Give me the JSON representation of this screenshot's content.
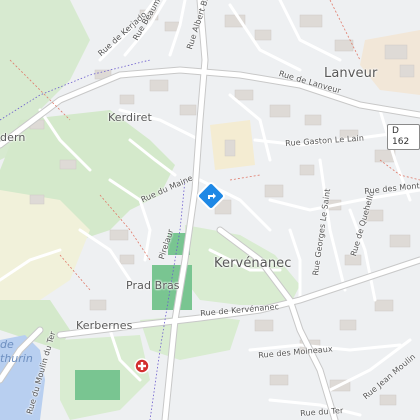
{
  "map": {
    "places": {
      "lanveur": "Lanveur",
      "kervenanec": "Kervénanec",
      "kerdiret": "Kerdiret",
      "prad_bras": "Prad Bras",
      "kerbernes": "Kerbernes",
      "dern": "dern"
    },
    "streets": {
      "rue_de_lanveur": "Rue de Lanveur",
      "rue_gaston_le_lain": "Rue Gaston Le Lain",
      "rue_du_maine": "Rue du Maine",
      "rue_de_kervenanec": "Rue de Kervénanec",
      "rue_des_moineaux": "Rue des Moineaux",
      "rue_de_quehello": "Rue de Quehello",
      "rue_georges_le_saint": "Rue Georges Le Saint",
      "rue_des_montagnes": "Rue des Monta",
      "rue_jean_moulin": "Rue Jean Moulin",
      "rue_du_moulin_du_ter": "Rue du Moulin du Ter",
      "rue_de_kerjado": "Rue de Kerjado",
      "rue_beaumont": "Rue Beaumont",
      "rue_albert_bricquette": "Rue Albert Bricquette",
      "rue_du_ter": "Rue du Ter",
      "pirelaur": "Pirelaur"
    },
    "road_shield": "D 162",
    "water_label": "thurin",
    "water_label_2": "de",
    "markers": {
      "main_pin_icon": "diamond-direction-icon",
      "hospital_icon": "red-cross-icon"
    },
    "colors": {
      "background": "#eef0f2",
      "park": "#d8ecd0",
      "park_dark": "#c9e3bf",
      "woodland": "#cfe6c4",
      "field": "#f0f0d8",
      "sports_pitch": "#77c48f",
      "water": "#b8cff0",
      "building": "#e0dcd8",
      "road": "#ffffff",
      "road_casing": "#c8c8c8",
      "marker": "#1e88e5",
      "hospital": "#d32f2f"
    }
  }
}
